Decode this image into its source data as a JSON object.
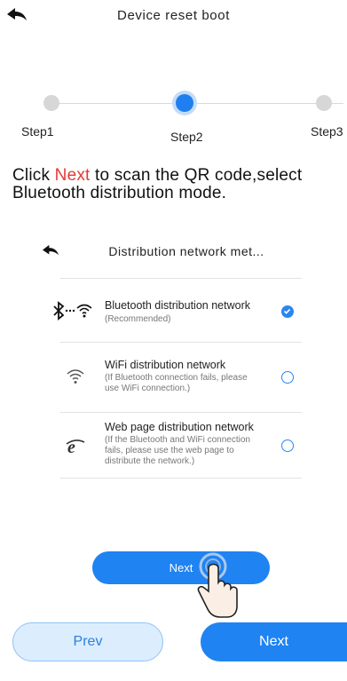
{
  "header": {
    "title": "Device reset boot"
  },
  "steps": [
    {
      "label": "Step1"
    },
    {
      "label": "Step2"
    },
    {
      "label": "Step3"
    }
  ],
  "instruction": {
    "prefix": "Click ",
    "highlight": "Next",
    "suffix": " to scan the QR code,select Bluetooth distribution mode."
  },
  "illustration": {
    "title": "Distribution network met...",
    "options": [
      {
        "title": "Bluetooth distribution network",
        "desc": "(Recommended)",
        "icon": "bluetooth-wifi-icon",
        "selected": true
      },
      {
        "title": "WiFi distribution network",
        "desc": "(If Bluetooth connection fails, please use WiFi connection.)",
        "icon": "wifi-icon",
        "selected": false
      },
      {
        "title": "Web page distribution network",
        "desc": "(If the Bluetooth and WiFi connection fails, please use the web page to distribute the network.)",
        "icon": "browser-icon",
        "selected": false
      }
    ],
    "next_label": "Next"
  },
  "footer": {
    "prev_label": "Prev",
    "next_label": "Next"
  },
  "colors": {
    "accent": "#1f83f2",
    "highlight": "#e53935"
  }
}
